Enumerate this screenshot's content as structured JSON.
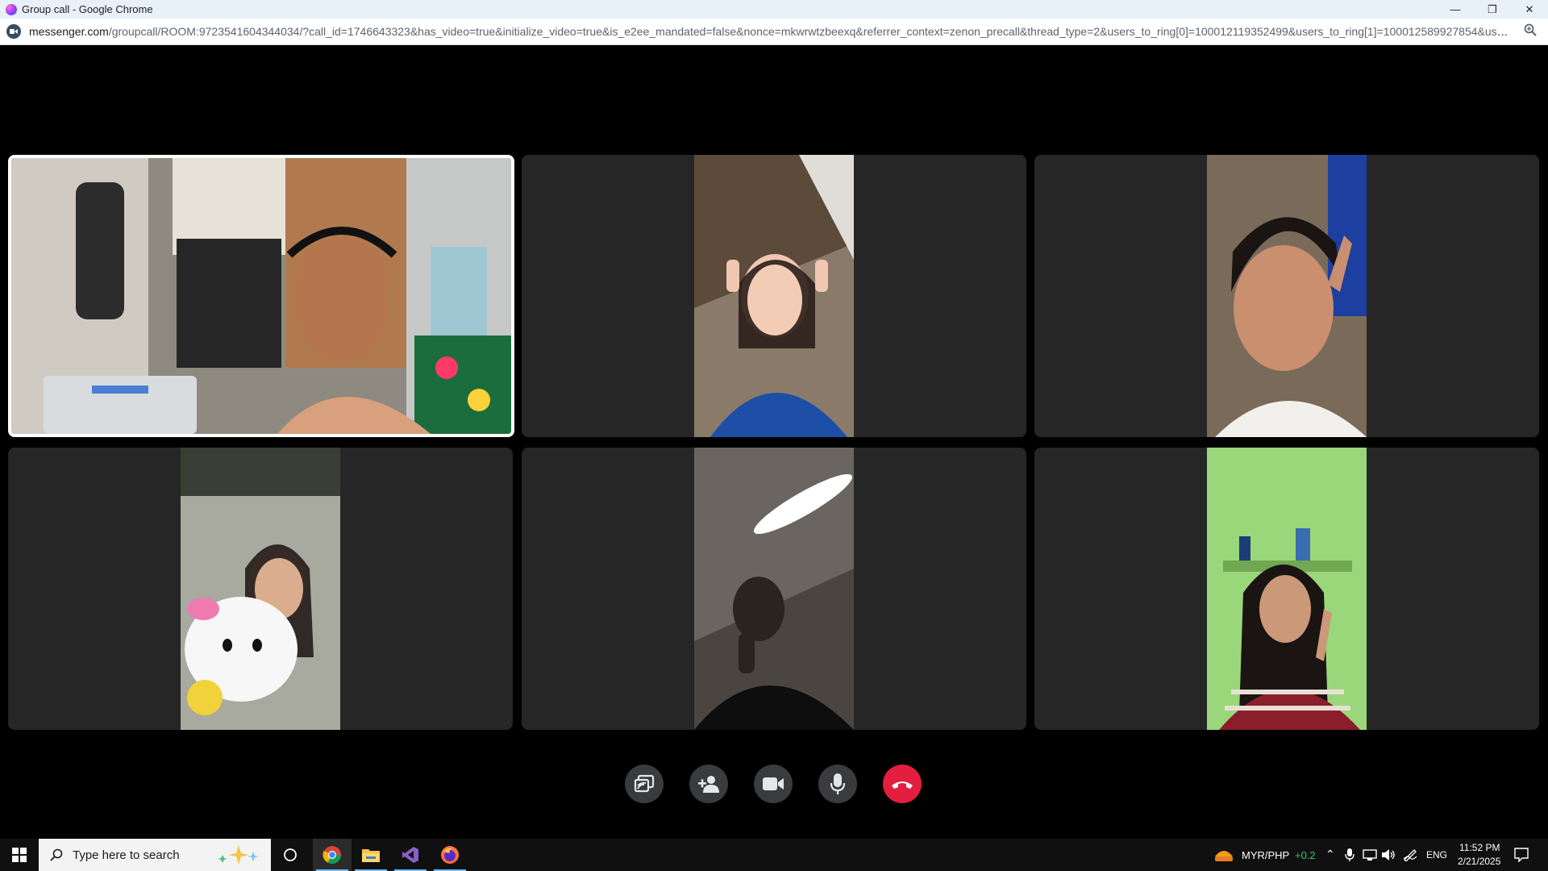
{
  "window": {
    "title": "Group call - Google Chrome",
    "minimize_glyph": "—",
    "restore_glyph": "❐",
    "close_glyph": "✕"
  },
  "address": {
    "host": "messenger.com",
    "path": "/groupcall/ROOM:9723541604344034/?call_id=1746643323&has_video=true&initialize_video=true&is_e2ee_mandated=false&nonce=mkwrwtzbeexq&referrer_context=zenon_precall&thread_type=2&users_to_ring[0]=100012119352499&users_to_ring[1]=100012589927854&user..."
  },
  "participants": [
    {
      "id": "p1",
      "active": true
    },
    {
      "id": "p2",
      "active": false
    },
    {
      "id": "p3",
      "active": false
    },
    {
      "id": "p4",
      "active": false
    },
    {
      "id": "p5",
      "active": false
    },
    {
      "id": "p6",
      "active": false
    }
  ],
  "controls": [
    {
      "name": "share-screen-button",
      "icon": "screen-share-icon"
    },
    {
      "name": "add-people-button",
      "icon": "add-person-icon"
    },
    {
      "name": "camera-button",
      "icon": "video-camera-icon"
    },
    {
      "name": "microphone-button",
      "icon": "microphone-icon"
    },
    {
      "name": "end-call-button",
      "icon": "hang-up-icon"
    }
  ],
  "taskbar": {
    "search_placeholder": "Type here to search",
    "currency": "MYR/PHP",
    "currency_change": "+0.2",
    "language": "ENG",
    "time": "11:52 PM",
    "date": "2/21/2025"
  },
  "colors": {
    "end_call": "#e41e3f",
    "tile_bg": "#262626",
    "currency_up": "#3ac26e"
  }
}
